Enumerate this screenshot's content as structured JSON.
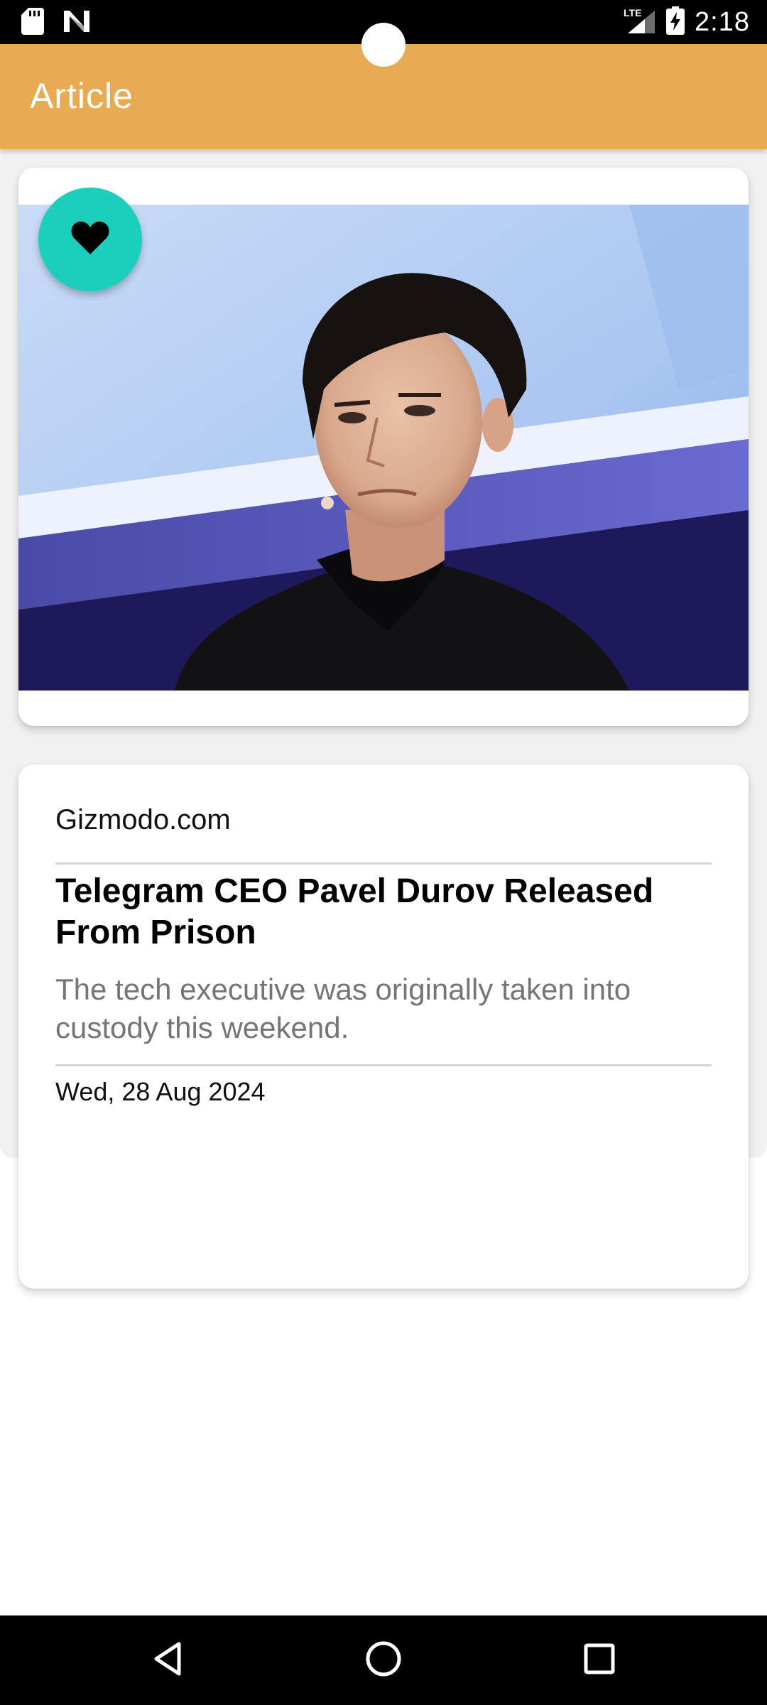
{
  "status_bar": {
    "time": "2:18",
    "network": "LTE",
    "left_icons": [
      "sd-card-icon",
      "n-logo-icon"
    ],
    "right_icons": [
      "lte-signal-icon",
      "battery-charging-icon"
    ]
  },
  "app_bar": {
    "title": "Article",
    "color": "#E8AB54"
  },
  "image_card": {
    "favorite_icon": "heart-icon",
    "favorite_color": "#1BCFBC"
  },
  "article": {
    "source": "Gizmodo.com",
    "title": "Telegram CEO Pavel Durov Released From Prison",
    "description": "The tech executive was originally taken into custody this weekend.",
    "date": "Wed, 28 Aug 2024"
  },
  "nav_bar": {
    "buttons": [
      "back-icon",
      "home-icon",
      "recents-icon"
    ]
  }
}
